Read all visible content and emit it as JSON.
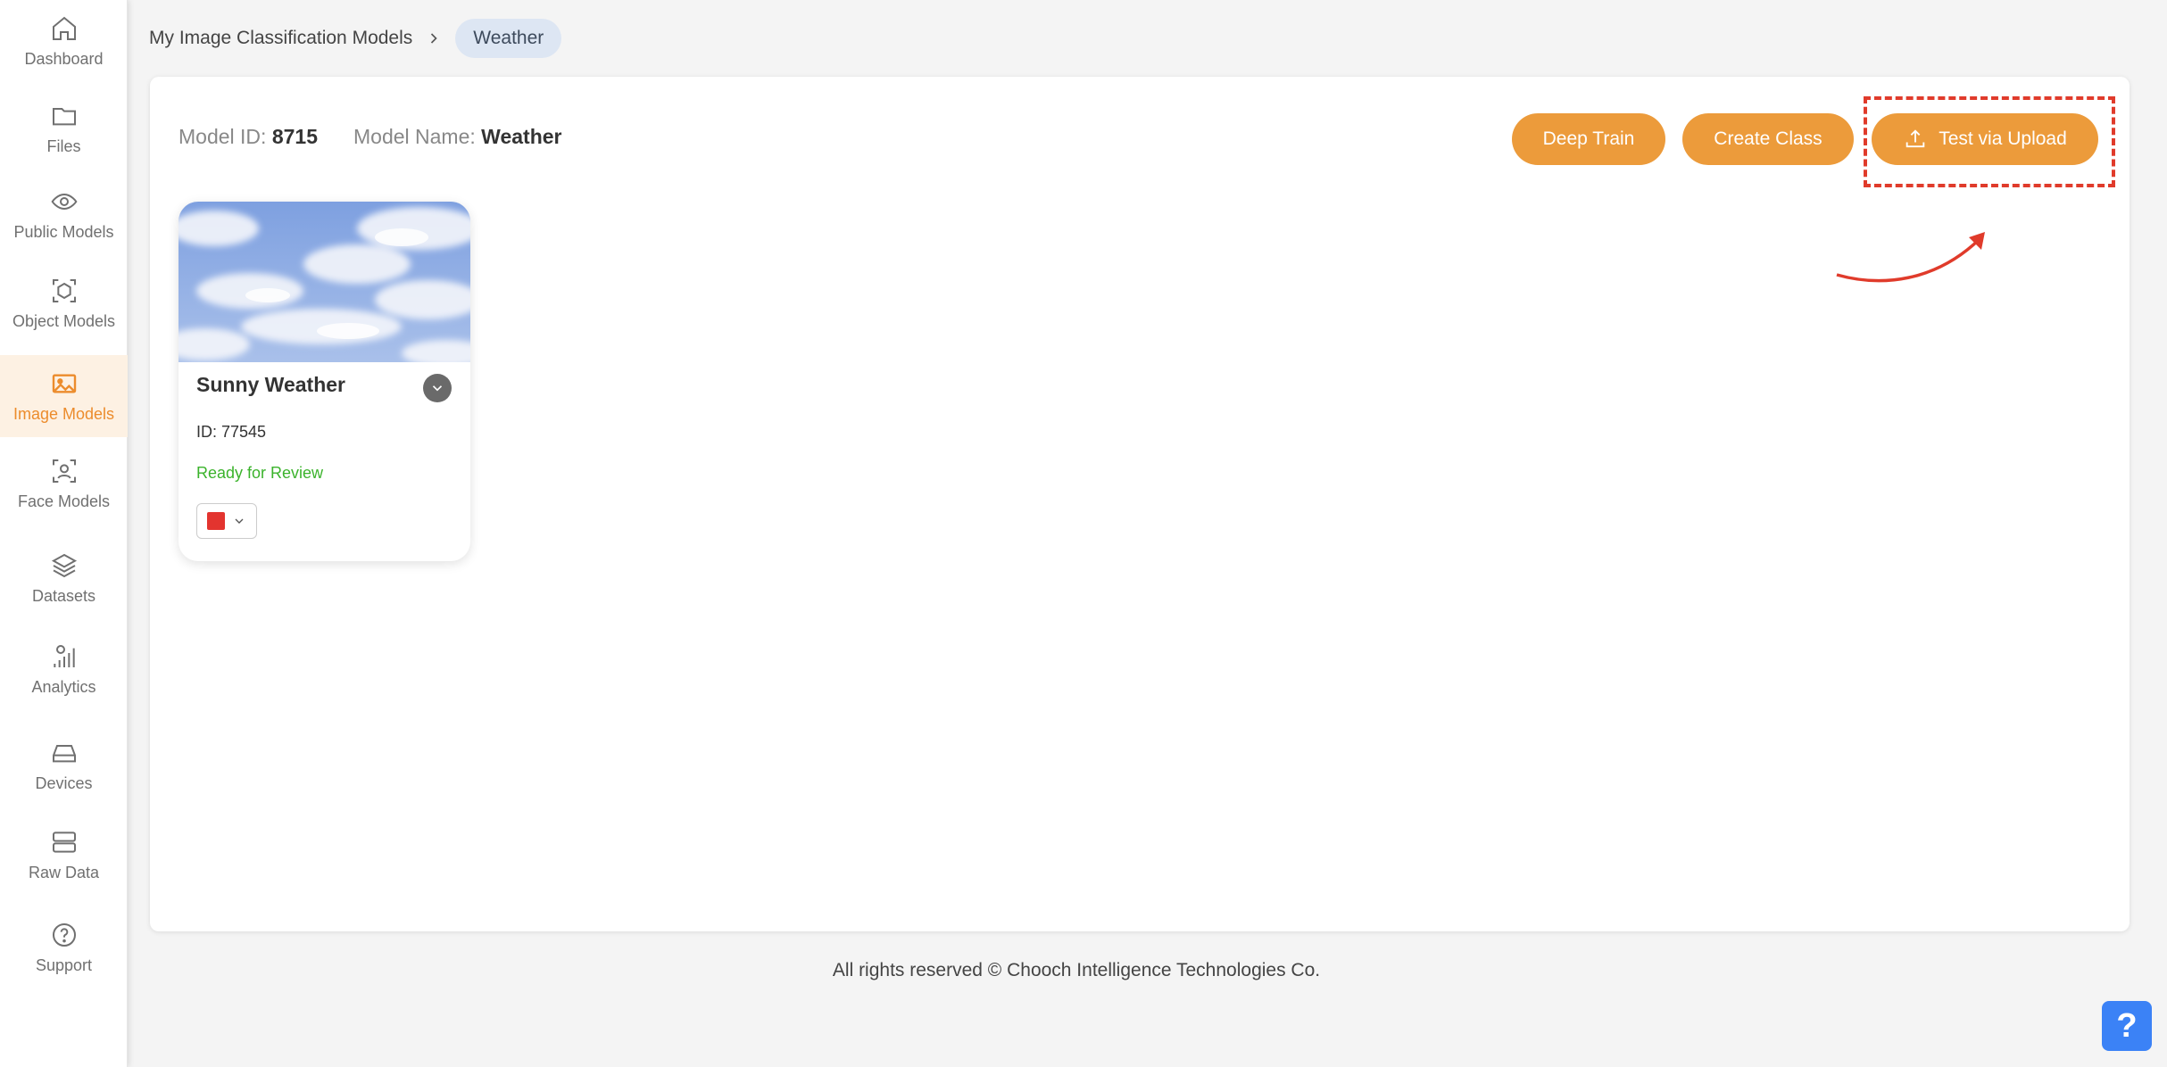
{
  "sidebar": {
    "items": [
      {
        "label": "Dashboard",
        "icon": "home-icon"
      },
      {
        "label": "Files",
        "icon": "folder-icon"
      },
      {
        "label": "Public Models",
        "icon": "eye-icon"
      },
      {
        "label": "Object Models",
        "icon": "cube-icon"
      },
      {
        "label": "Image Models",
        "icon": "image-icon",
        "active": true
      },
      {
        "label": "Face Models",
        "icon": "face-scan-icon"
      },
      {
        "label": "Datasets",
        "icon": "layers-icon"
      },
      {
        "label": "Analytics",
        "icon": "analytics-icon"
      },
      {
        "label": "Devices",
        "icon": "hard-drive-icon"
      },
      {
        "label": "Raw Data",
        "icon": "server-icon"
      },
      {
        "label": "Support",
        "icon": "help-circle-icon"
      }
    ]
  },
  "breadcrumb": {
    "parent": "My Image Classification Models",
    "current": "Weather"
  },
  "model": {
    "id_label": "Model ID:",
    "id_value": "8715",
    "name_label": "Model Name:",
    "name_value": "Weather"
  },
  "toolbar": {
    "deep_train_label": "Deep Train",
    "create_class_label": "Create Class",
    "test_upload_label": "Test via Upload"
  },
  "classes": [
    {
      "name": "Sunny Weather",
      "id_text": "ID: 77545",
      "status": "Ready for Review",
      "color": "#e3342f"
    }
  ],
  "footer": {
    "text": "All rights reserved © Chooch Intelligence Technologies Co."
  },
  "help_fab": {
    "label": "?"
  },
  "colors": {
    "accent": "#ec9b3b",
    "active_nav": "#ec8c2c",
    "status_ok": "#3bb32c",
    "annotation": "#e03b2b",
    "help": "#3b82f6"
  }
}
